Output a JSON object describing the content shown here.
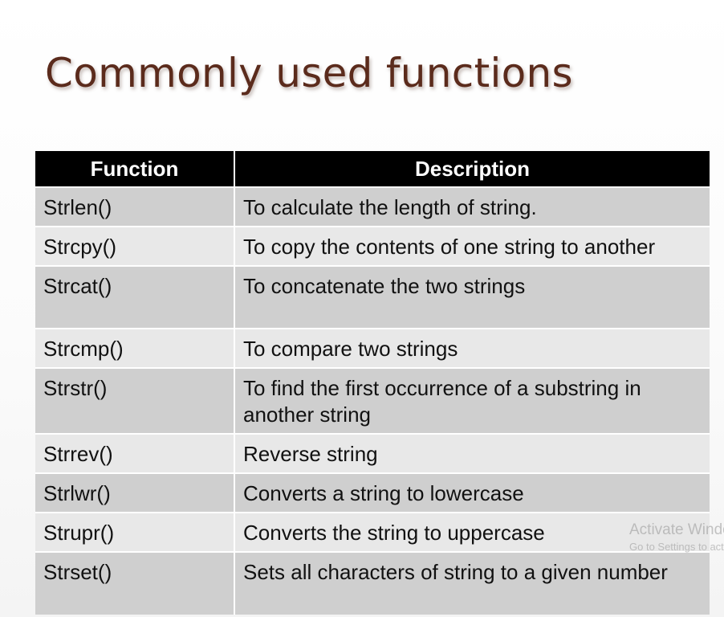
{
  "title": "Commonly used functions",
  "table": {
    "headers": [
      "Function",
      "Description"
    ],
    "rows": [
      {
        "function": "Strlen()",
        "description": "To calculate the length of string."
      },
      {
        "function": "Strcpy()",
        "description": "To copy the  contents of one string to another"
      },
      {
        "function": "Strcat()",
        "description": "To concatenate the two strings"
      },
      {
        "function": "Strcmp()",
        "description": "To compare two strings"
      },
      {
        "function": "Strstr()",
        "description": "To find the first occurrence of a substring in another string"
      },
      {
        "function": "Strrev()",
        "description": "Reverse string"
      },
      {
        "function": "Strlwr()",
        "description": "Converts a string to lowercase"
      },
      {
        "function": "Strupr()",
        "description": "Converts the string to uppercase"
      },
      {
        "function": "Strset()",
        "description": "Sets all characters of string to a given number"
      }
    ]
  },
  "watermark": {
    "line1": "Activate Windows",
    "line2": "Go to Settings to activate Windows."
  },
  "colors": {
    "title": "#5b2b1c",
    "header_bg": "#000000",
    "row_dark": "#cfcfcf",
    "row_light": "#e8e8e8"
  }
}
